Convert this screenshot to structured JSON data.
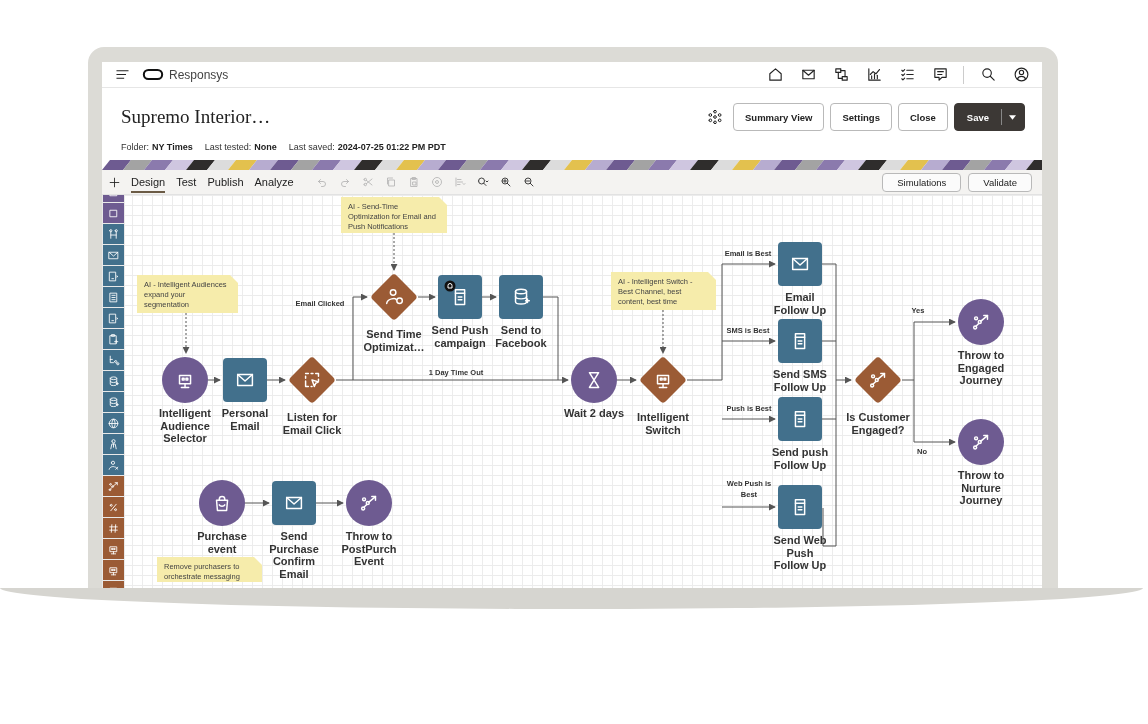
{
  "app": {
    "brand": "Responsys"
  },
  "page": {
    "title": "Supremo Interior…",
    "meta": [
      {
        "label": "Folder:",
        "value": "NY Times"
      },
      {
        "label": "Last tested:",
        "value": "None"
      },
      {
        "label": "Last saved:",
        "value": "2024-07-25 01:22 PM PDT"
      }
    ],
    "buttons": [
      {
        "label": "Summary View",
        "kind": "plain"
      },
      {
        "label": "Settings",
        "kind": "plain"
      },
      {
        "label": "Close",
        "kind": "plain"
      },
      {
        "label": "Save",
        "kind": "split"
      }
    ]
  },
  "toolbar": {
    "tabs": [
      {
        "label": "Design",
        "selected": true
      },
      {
        "label": "Test",
        "selected": false
      },
      {
        "label": "Publish",
        "selected": false
      },
      {
        "label": "Analyze",
        "selected": false
      }
    ],
    "tools": [
      {
        "disabled": true
      },
      {
        "disabled": true
      },
      {
        "disabled": true
      },
      {
        "disabled": true
      },
      {
        "disabled": true
      },
      {
        "disabled": true
      },
      {
        "disabled": true
      },
      {
        "disabled": false
      },
      {
        "disabled": false
      },
      {
        "disabled": false
      }
    ],
    "buttons": [
      "Simulations",
      "Validate"
    ]
  },
  "canvas": {
    "nodes": [
      {
        "label": "Intelligent Audience Selector",
        "kind": "circle",
        "badge": false
      },
      {
        "label": "Personal Email",
        "kind": "square",
        "badge": false
      },
      {
        "label": "Listen for Email Click",
        "kind": "diamond",
        "badge": false
      },
      {
        "label": "Send Time Optimizat…",
        "kind": "diamond",
        "badge": false
      },
      {
        "label": "Send Push campaign",
        "kind": "square",
        "badge": true
      },
      {
        "label": "Send to Facebook",
        "kind": "square",
        "badge": false
      },
      {
        "label": "Wait 2 days",
        "kind": "circle",
        "badge": false
      },
      {
        "label": "Intelligent Switch",
        "kind": "diamond",
        "badge": false
      },
      {
        "label": "Email Follow Up",
        "kind": "square",
        "badge": false
      },
      {
        "label": "Send SMS Follow Up",
        "kind": "square",
        "badge": false
      },
      {
        "label": "Send push Follow Up",
        "kind": "square",
        "badge": false
      },
      {
        "label": "Send Web Push Follow Up",
        "kind": "square",
        "badge": false
      },
      {
        "label": "Is Customer Engaged?",
        "kind": "diamond",
        "badge": false
      },
      {
        "label": "Throw to Engaged Journey",
        "kind": "circle",
        "badge": false
      },
      {
        "label": "Throw to Nurture Journey",
        "kind": "circle",
        "badge": false
      },
      {
        "label": "Purchase event",
        "kind": "circle",
        "badge": false
      },
      {
        "label": "Send Purchase Confirm Email",
        "kind": "square",
        "badge": false
      },
      {
        "label": "Throw to PostPurch Event",
        "kind": "circle",
        "badge": false
      }
    ],
    "edge_labels": [
      "Email Clicked",
      "1 Day Time Out",
      "Email is Best",
      "SMS is Best",
      "Push is Best",
      "Web Push is Best",
      "Yes",
      "No"
    ],
    "notes": [
      "AI - Intelligent Audiences expand your segmentation",
      "AI - Send-Time Optimization for Email and Push Notifications",
      "AI - Intelligent Switch - Best Channel, best content, best time",
      "Remove purchasers to orchestrate messaging"
    ]
  }
}
